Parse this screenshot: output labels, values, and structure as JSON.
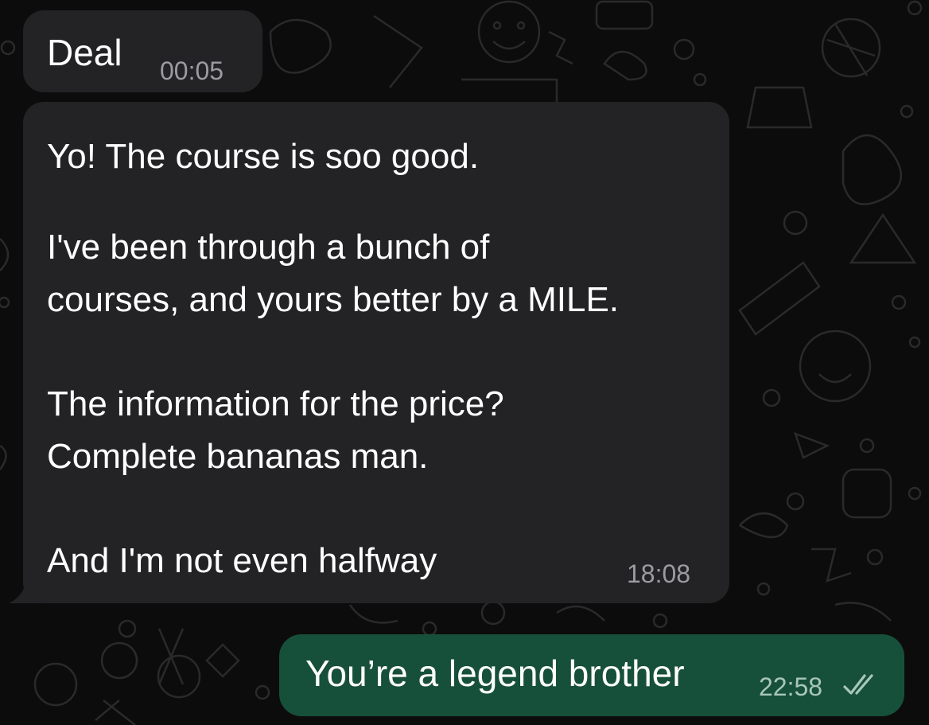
{
  "messages": [
    {
      "direction": "incoming",
      "text": "Deal",
      "time": "00:05"
    },
    {
      "direction": "incoming",
      "lines": [
        "Yo! The course is soo good.",
        "I've been through a bunch of",
        "courses, and yours better by a MILE.",
        "The information for the price?",
        "Complete bananas man.",
        "And I'm not even halfway"
      ],
      "time": "18:08"
    },
    {
      "direction": "outgoing",
      "text": "You’re a legend brother",
      "time": "22:58",
      "status_icon": "double-check-icon"
    }
  ],
  "colors": {
    "chat_background": "#0c0c0c",
    "incoming_bubble": "#232326",
    "outgoing_bubble": "#17503a",
    "timestamp_incoming": "#9c9ca0",
    "timestamp_outgoing": "#a8c7b8"
  }
}
